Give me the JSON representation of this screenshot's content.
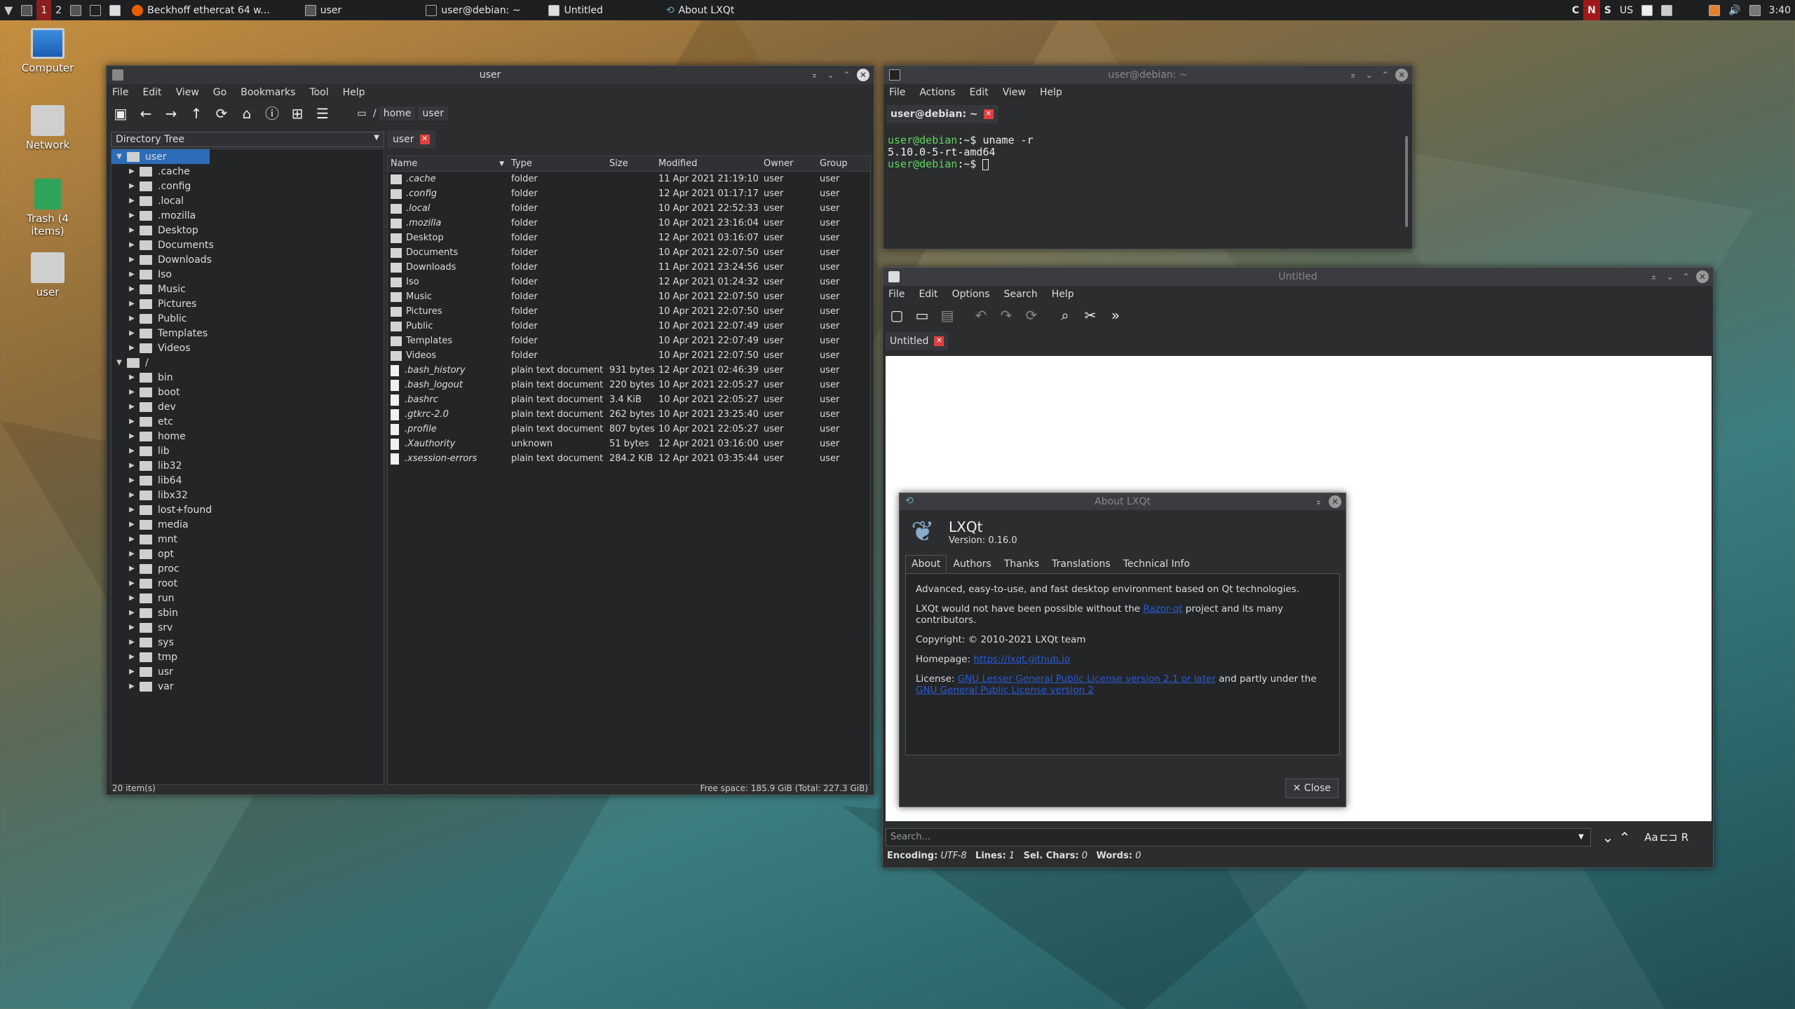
{
  "taskbar": {
    "desktop1": "1",
    "desktop2": "2",
    "tasks": [
      "Beckhoff ethercat 64 w...",
      "user",
      "user@debian: ~",
      "Untitled",
      "About LXQt"
    ],
    "tray": [
      "C",
      "N",
      "S"
    ],
    "layout": "US",
    "clock": "3:40"
  },
  "desktop": {
    "icons": [
      "Computer",
      "Network",
      "Trash (4 items)",
      "user"
    ]
  },
  "fm": {
    "title": "user",
    "menu": [
      "File",
      "Edit",
      "View",
      "Go",
      "Bookmarks",
      "Tool",
      "Help"
    ],
    "path": [
      "/",
      "home",
      "user"
    ],
    "tab": "user",
    "tree_label": "Directory Tree",
    "tree": {
      "root_user": "user",
      "user_children": [
        ".cache",
        ".config",
        ".local",
        ".mozilla",
        "Desktop",
        "Documents",
        "Downloads",
        "Iso",
        "Music",
        "Pictures",
        "Public",
        "Templates",
        "Videos"
      ],
      "root": "/",
      "root_children": [
        "bin",
        "boot",
        "dev",
        "etc",
        "home",
        "lib",
        "lib32",
        "lib64",
        "libx32",
        "lost+found",
        "media",
        "mnt",
        "opt",
        "proc",
        "root",
        "run",
        "sbin",
        "srv",
        "sys",
        "tmp",
        "usr",
        "var"
      ]
    },
    "columns": [
      "Name",
      "Type",
      "Size",
      "Modified",
      "Owner",
      "Group"
    ],
    "rows": [
      {
        "name": ".cache",
        "type": "folder",
        "size": "",
        "mod": "11 Apr 2021 21:19:10",
        "owner": "user",
        "group": "user",
        "kind": "folder",
        "italic": true
      },
      {
        "name": ".config",
        "type": "folder",
        "size": "",
        "mod": "12 Apr 2021 01:17:17",
        "owner": "user",
        "group": "user",
        "kind": "folder",
        "italic": true
      },
      {
        "name": ".local",
        "type": "folder",
        "size": "",
        "mod": "10 Apr 2021 22:52:33",
        "owner": "user",
        "group": "user",
        "kind": "folder",
        "italic": true
      },
      {
        "name": ".mozilla",
        "type": "folder",
        "size": "",
        "mod": "10 Apr 2021 23:16:04",
        "owner": "user",
        "group": "user",
        "kind": "folder",
        "italic": true
      },
      {
        "name": "Desktop",
        "type": "folder",
        "size": "",
        "mod": "12 Apr 2021 03:16:07",
        "owner": "user",
        "group": "user",
        "kind": "folder",
        "italic": false
      },
      {
        "name": "Documents",
        "type": "folder",
        "size": "",
        "mod": "10 Apr 2021 22:07:50",
        "owner": "user",
        "group": "user",
        "kind": "folder",
        "italic": false
      },
      {
        "name": "Downloads",
        "type": "folder",
        "size": "",
        "mod": "11 Apr 2021 23:24:56",
        "owner": "user",
        "group": "user",
        "kind": "folder",
        "italic": false
      },
      {
        "name": "Iso",
        "type": "folder",
        "size": "",
        "mod": "12 Apr 2021 01:24:32",
        "owner": "user",
        "group": "user",
        "kind": "folder",
        "italic": false
      },
      {
        "name": "Music",
        "type": "folder",
        "size": "",
        "mod": "10 Apr 2021 22:07:50",
        "owner": "user",
        "group": "user",
        "kind": "folder",
        "italic": false
      },
      {
        "name": "Pictures",
        "type": "folder",
        "size": "",
        "mod": "10 Apr 2021 22:07:50",
        "owner": "user",
        "group": "user",
        "kind": "folder",
        "italic": false
      },
      {
        "name": "Public",
        "type": "folder",
        "size": "",
        "mod": "10 Apr 2021 22:07:49",
        "owner": "user",
        "group": "user",
        "kind": "folder",
        "italic": false
      },
      {
        "name": "Templates",
        "type": "folder",
        "size": "",
        "mod": "10 Apr 2021 22:07:49",
        "owner": "user",
        "group": "user",
        "kind": "folder",
        "italic": false
      },
      {
        "name": "Videos",
        "type": "folder",
        "size": "",
        "mod": "10 Apr 2021 22:07:50",
        "owner": "user",
        "group": "user",
        "kind": "folder",
        "italic": false
      },
      {
        "name": ".bash_history",
        "type": "plain text document",
        "size": "931 bytes",
        "mod": "12 Apr 2021 02:46:39",
        "owner": "user",
        "group": "user",
        "kind": "doc",
        "italic": true
      },
      {
        "name": ".bash_logout",
        "type": "plain text document",
        "size": "220 bytes",
        "mod": "10 Apr 2021 22:05:27",
        "owner": "user",
        "group": "user",
        "kind": "doc",
        "italic": true
      },
      {
        "name": ".bashrc",
        "type": "plain text document",
        "size": "3.4 KiB",
        "mod": "10 Apr 2021 22:05:27",
        "owner": "user",
        "group": "user",
        "kind": "doc",
        "italic": true
      },
      {
        "name": ".gtkrc-2.0",
        "type": "plain text document",
        "size": "262 bytes",
        "mod": "10 Apr 2021 23:25:40",
        "owner": "user",
        "group": "user",
        "kind": "doc",
        "italic": true
      },
      {
        "name": ".profile",
        "type": "plain text document",
        "size": "807 bytes",
        "mod": "10 Apr 2021 22:05:27",
        "owner": "user",
        "group": "user",
        "kind": "doc",
        "italic": true
      },
      {
        "name": ".Xauthority",
        "type": "unknown",
        "size": "51 bytes",
        "mod": "12 Apr 2021 03:16:00",
        "owner": "user",
        "group": "user",
        "kind": "doc",
        "italic": true
      },
      {
        "name": ".xsession-errors",
        "type": "plain text document",
        "size": "284.2 KiB",
        "mod": "12 Apr 2021 03:35:44",
        "owner": "user",
        "group": "user",
        "kind": "doc",
        "italic": true
      }
    ],
    "status_left": "20 item(s)",
    "status_right": "Free space: 185.9 GiB (Total: 227.3 GiB)"
  },
  "term": {
    "title": "user@debian: ~",
    "menu": [
      "File",
      "Actions",
      "Edit",
      "View",
      "Help"
    ],
    "tab": "user@debian: ~",
    "prompt": "user@debian",
    "prompt_rest": ":~$ ",
    "cmd": "uname -r",
    "output": "5.10.0-5-rt-amd64"
  },
  "editor": {
    "title": "Untitled",
    "menu": [
      "File",
      "Edit",
      "Options",
      "Search",
      "Help"
    ],
    "tab": "Untitled",
    "search_placeholder": "Search...",
    "status": {
      "enc_label": "Encoding:",
      "enc": "UTF-8",
      "lines_label": "Lines:",
      "lines": "1",
      "sel_label": "Sel. Chars:",
      "sel": "0",
      "words_label": "Words:",
      "words": "0"
    }
  },
  "about": {
    "title": "About LXQt",
    "name": "LXQt",
    "version": "Version: 0.16.0",
    "tabs": [
      "About",
      "Authors",
      "Thanks",
      "Translations",
      "Technical Info"
    ],
    "p1": "Advanced, easy-to-use, and fast desktop environment based on Qt technologies.",
    "p2a": "LXQt would not have been possible without the ",
    "p2link": "Razor-qt",
    "p2b": " project and its many contributors.",
    "p3": "Copyright: © 2010-2021 LXQt team",
    "p4label": "Homepage: ",
    "p4link": "https://lxqt.github.io",
    "p5label": "License: ",
    "p5link1": "GNU Lesser General Public License version 2.1 or later",
    "p5mid": " and partly under the ",
    "p5link2": "GNU General Public License version 2",
    "close": "Close"
  }
}
